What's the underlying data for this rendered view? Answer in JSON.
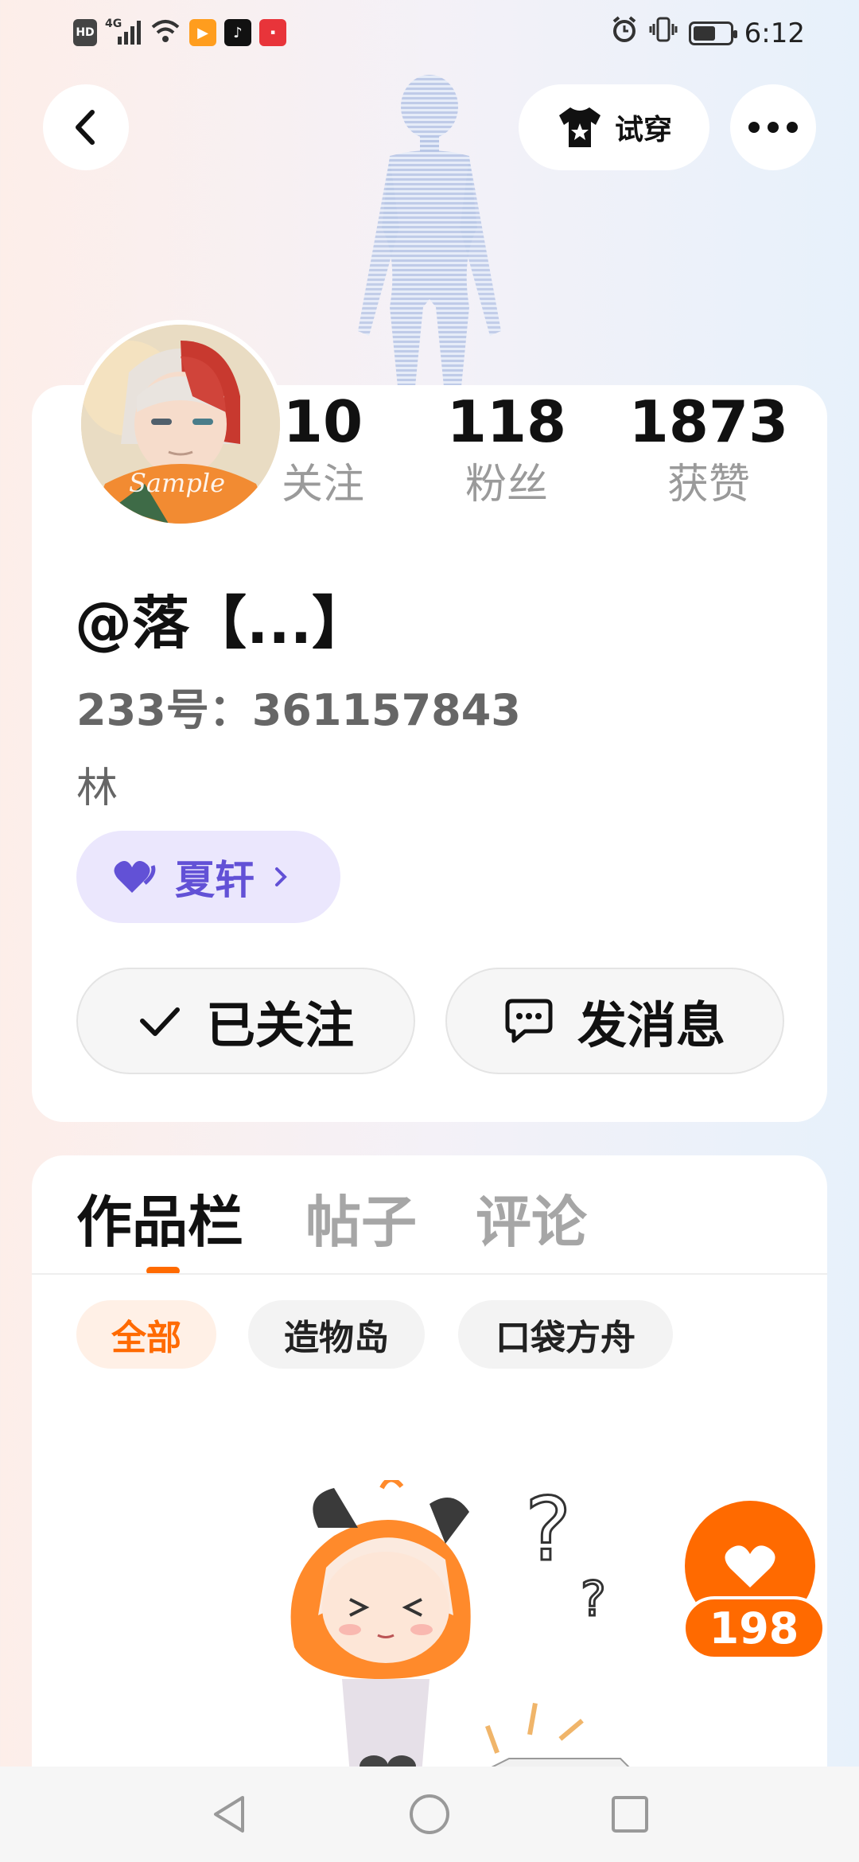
{
  "status_bar": {
    "hd": "HD",
    "net": "4G",
    "time": "6:12",
    "battery_level": 0.55
  },
  "top_bar": {
    "back_icon": "chevron-left-icon",
    "tryon_label": "试穿",
    "more_icon": "more-dots-icon"
  },
  "profile": {
    "stats": [
      {
        "value": "10",
        "label": "关注"
      },
      {
        "value": "118",
        "label": "粉丝"
      },
      {
        "value": "1873",
        "label": "获赞"
      }
    ],
    "username": "@落【...】",
    "id_line": "233号：361157843",
    "bio": "林",
    "badge": {
      "label": "夏轩",
      "icon": "heart-icon"
    },
    "follow_button": "已关注",
    "message_button": "发消息"
  },
  "works": {
    "tabs": [
      "作品栏",
      "帖子",
      "评论"
    ],
    "active_tab": 0,
    "filters": [
      "全部",
      "造物岛",
      "口袋方舟"
    ],
    "active_filter": 0
  },
  "like": {
    "count": "198"
  },
  "colors": {
    "accent": "#ff6a00",
    "badge_purple": "#6251d6"
  }
}
